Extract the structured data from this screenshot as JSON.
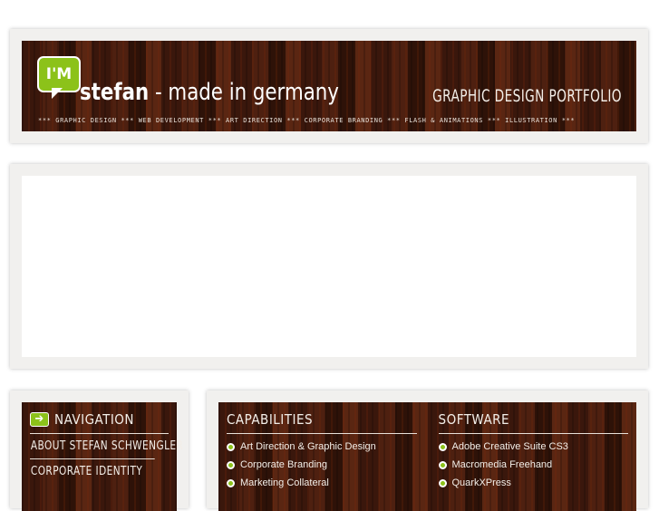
{
  "header": {
    "logo_text": "I'M",
    "name": "stefan",
    "tagline": "- made in germany",
    "portfolio": "GRAPHIC DESIGN PORTFOLIO",
    "strip": "*** GRAPHIC DESIGN *** WEB DEVELOPMENT *** ART DIRECTION *** CORPORATE BRANDING *** FLASH & ANIMATIONS *** ILLUSTRATION ***"
  },
  "navigation": {
    "title": "NAVIGATION",
    "items": [
      {
        "label": "ABOUT STEFAN SCHWENGLER"
      },
      {
        "label": "CORPORATE IDENTITY"
      }
    ]
  },
  "capabilities": {
    "title": "CAPABILITIES",
    "items": [
      "Art Direction & Graphic Design",
      "Corporate Branding",
      "Marketing Collateral"
    ]
  },
  "software": {
    "title": "SOFTWARE",
    "items": [
      "Adobe Creative Suite CS3",
      "Macromedia Freehand",
      "QuarkXPress"
    ]
  },
  "colors": {
    "accent": "#8cc21a",
    "wood": "#3a170c",
    "card": "#f1f0ee"
  }
}
